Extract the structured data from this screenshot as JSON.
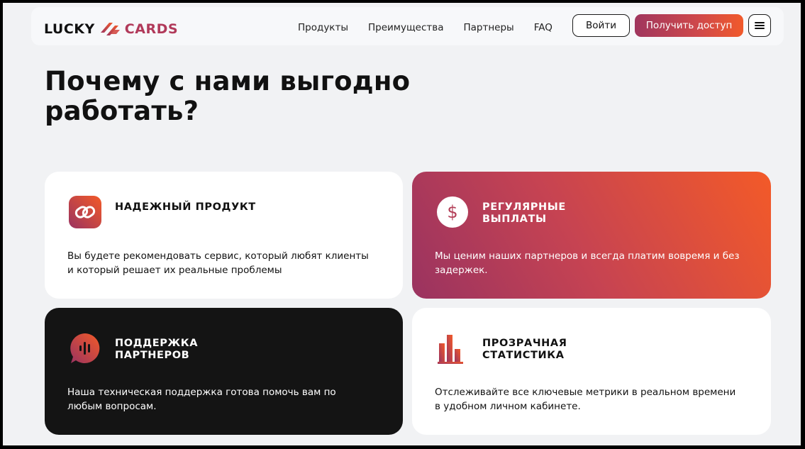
{
  "header": {
    "logo": {
      "left": "LUCKY",
      "right": "CARDS"
    },
    "nav": [
      "Продукты",
      "Преимущества",
      "Партнеры",
      "FAQ"
    ],
    "login_label": "Войти",
    "access_label": "Получить доступ",
    "menu_icon": "hamburger-icon"
  },
  "section": {
    "title": "Почему с нами выгодно работать?"
  },
  "cards": [
    {
      "title": "НАДЕЖНЫЙ ПРОДУКТ",
      "desc": "Вы будете рекомендовать сервис, который любят клиенты и который решает их реальные проблемы",
      "icon": "link-icon"
    },
    {
      "title": "РЕГУЛЯРНЫЕ ВЫПЛАТЫ",
      "desc": "Мы ценим наших партнеров и всегда платим вовремя и без задержек.",
      "icon": "dollar-icon"
    },
    {
      "title": "ПОДДЕРЖКА ПАРТНЕРОВ",
      "desc": "Наша техническая поддержка готова помочь вам по любым вопросам.",
      "icon": "chat-icon"
    },
    {
      "title": "ПРОЗРАЧНАЯ СТАТИСТИКА",
      "desc": "Отслеживайте все ключевые метрики в реальном времени в удобном личном кабинете.",
      "icon": "bar-chart-icon"
    }
  ],
  "colors": {
    "accent_start": "#9a3360",
    "accent_end": "#f35a28",
    "dark_card": "#141414",
    "page_bg": "#f1f2f4"
  }
}
